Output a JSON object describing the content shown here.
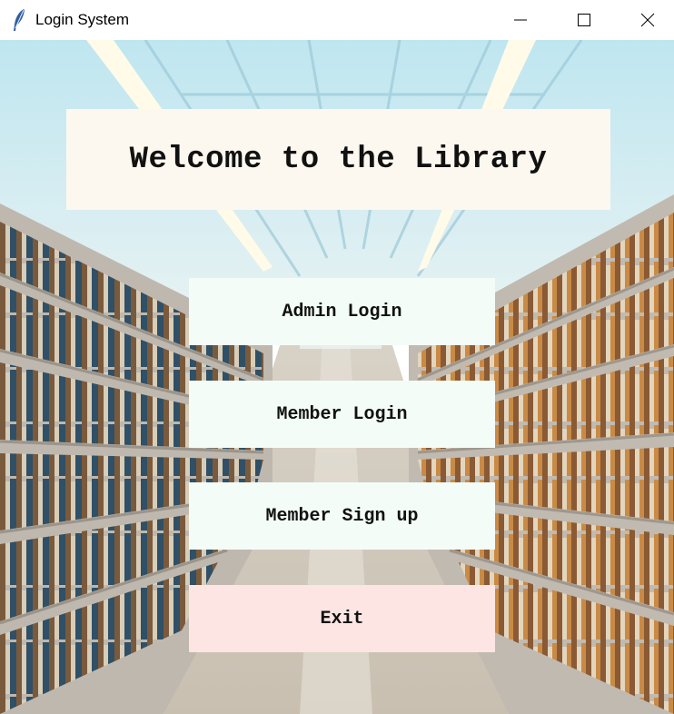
{
  "window": {
    "title": "Login System",
    "icon": "feather-icon"
  },
  "banner": {
    "text": "Welcome to the Library"
  },
  "menu": {
    "admin_login": "Admin Login",
    "member_login": "Member Login",
    "member_signup": "Member Sign up",
    "exit": "Exit"
  },
  "colors": {
    "banner_bg": "#fdf8ef",
    "button_bg": "#f4fcf7",
    "exit_bg": "#fde5e3"
  }
}
